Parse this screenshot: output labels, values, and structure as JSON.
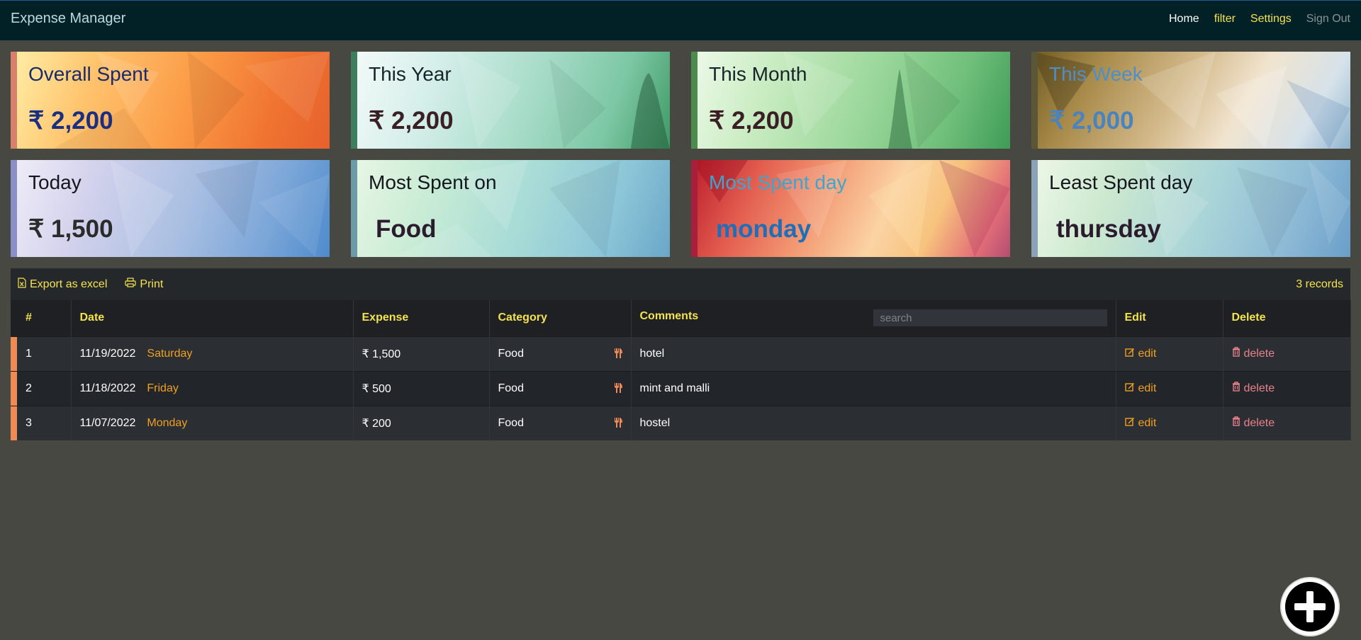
{
  "app": {
    "title": "Expense Manager"
  },
  "nav": {
    "home": "Home",
    "filter": "filter",
    "settings": "Settings",
    "signout": "Sign Out"
  },
  "cards": [
    {
      "title": "Overall Spent",
      "value": "₹ 2,200"
    },
    {
      "title": "This Year",
      "value": "₹ 2,200"
    },
    {
      "title": "This Month",
      "value": "₹ 2,200"
    },
    {
      "title": "This Week",
      "value": "₹ 2,000"
    },
    {
      "title": "Today",
      "value": "₹ 1,500"
    },
    {
      "title": "Most Spent on",
      "value": "Food"
    },
    {
      "title": "Most Spent day",
      "value": "monday"
    },
    {
      "title": "Least Spent day",
      "value": "thursday"
    }
  ],
  "toolbar": {
    "export": "Export as excel",
    "print": "Print",
    "records": "3 records"
  },
  "table": {
    "headers": {
      "num": "#",
      "date": "Date",
      "expense": "Expense",
      "category": "Category",
      "comments": "Comments",
      "edit": "Edit",
      "delete": "Delete"
    },
    "search_placeholder": "search",
    "rows": [
      {
        "num": "1",
        "date": "11/19/2022",
        "day": "Saturday",
        "expense": "₹ 1,500",
        "category": "Food",
        "comment": "hotel",
        "edit": "edit",
        "delete": "delete"
      },
      {
        "num": "2",
        "date": "11/18/2022",
        "day": "Friday",
        "expense": "₹ 500",
        "category": "Food",
        "comment": "mint and malli",
        "edit": "edit",
        "delete": "delete"
      },
      {
        "num": "3",
        "date": "11/07/2022",
        "day": "Monday",
        "expense": "₹ 200",
        "category": "Food",
        "comment": "hostel",
        "edit": "edit",
        "delete": "delete"
      }
    ]
  },
  "colors": {
    "navbar": "#022127",
    "accent_yellow": "#f5e34e",
    "accent_orange": "#f0a020",
    "row_accent": "#f08a55",
    "background": "#474841"
  },
  "icons": {
    "export": "file-excel-icon",
    "print": "print-icon",
    "category": "cutlery-icon",
    "edit": "edit-icon",
    "delete": "trash-icon",
    "fab": "plus-circle-icon"
  }
}
